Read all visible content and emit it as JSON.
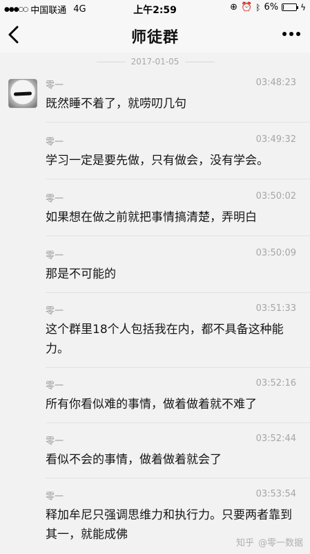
{
  "status_bar": {
    "carrier": "中国联通",
    "network": "4G",
    "time": "上午2:59",
    "battery_percent": "6%",
    "battery_level": 0.06
  },
  "nav": {
    "back_icon": "chevron-left-icon",
    "title": "师徒群",
    "more_icon": "more-dots-icon"
  },
  "date_separator": "2017-01-05",
  "messages": [
    {
      "name": "零一",
      "time": "03:48:23",
      "text": "既然睡不着了，就唠叨几句"
    },
    {
      "name": "零一",
      "time": "03:49:32",
      "text": "学习一定是要先做，只有做会，没有学会。"
    },
    {
      "name": "零一",
      "time": "03:50:02",
      "text": "如果想在做之前就把事情搞清楚，弄明白"
    },
    {
      "name": "零一",
      "time": "03:50:09",
      "text": "那是不可能的"
    },
    {
      "name": "零一",
      "time": "03:51:33",
      "text": "这个群里18个人包括我在内，都不具备这种能力。"
    },
    {
      "name": "零一",
      "time": "03:52:16",
      "text": "所有你看似难的事情，做着做着就不难了"
    },
    {
      "name": "零一",
      "time": "03:52:44",
      "text": "看似不会的事情，做着做着就会了"
    },
    {
      "name": "零一",
      "time": "03:53:54",
      "text": "释加牟尼只强调思维力和执行力。只要两者靠到其一，就能成佛"
    }
  ],
  "watermark": {
    "site": "知乎",
    "author": "@零一数据"
  }
}
